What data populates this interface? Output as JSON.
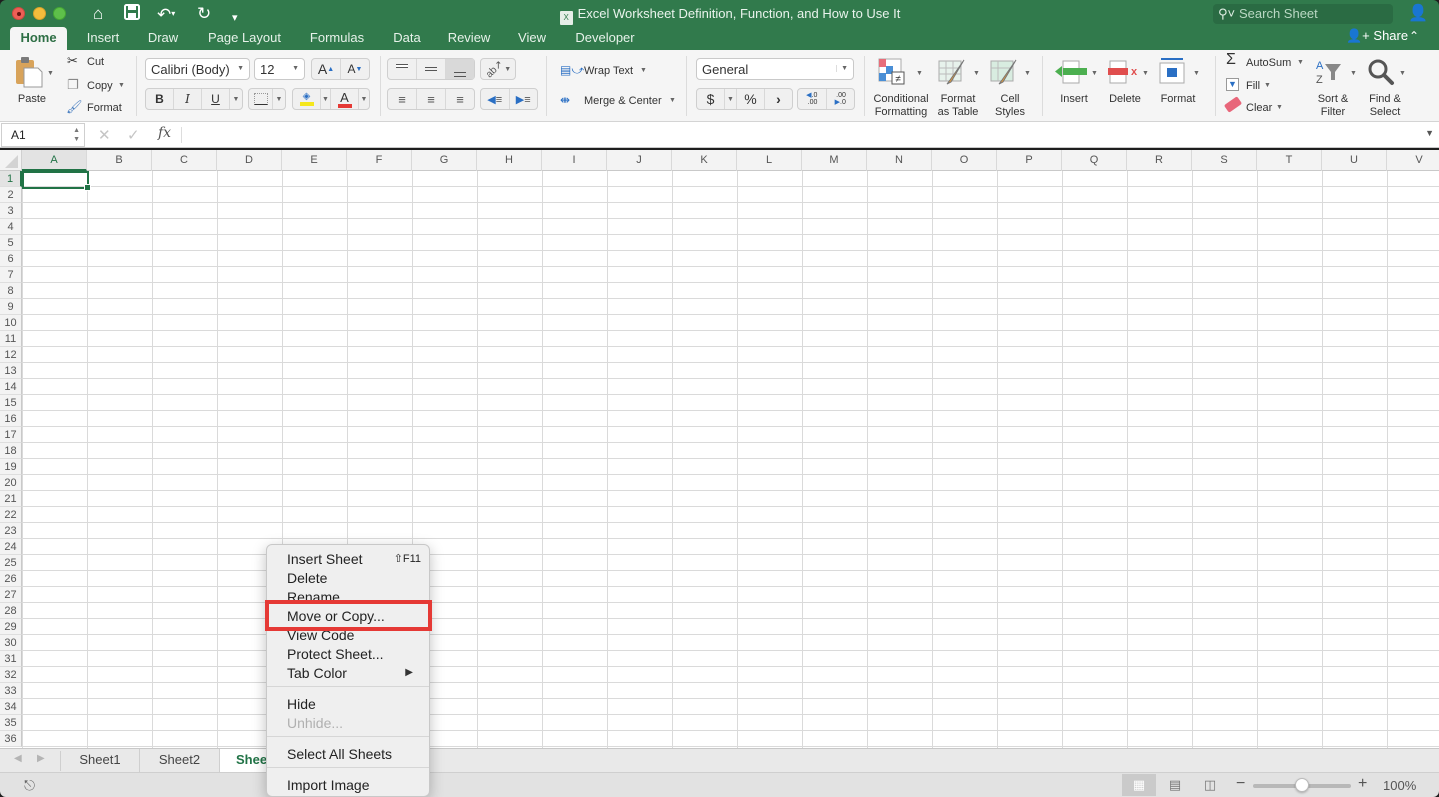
{
  "window": {
    "title": "Excel Worksheet Definition, Function, and How to Use It",
    "search_placeholder": "Search Sheet",
    "share_label": "Share"
  },
  "quick_access": [
    "home-icon",
    "save-icon",
    "undo-icon",
    "redo-icon",
    "customize-icon"
  ],
  "ribbon_tabs": [
    {
      "label": "Home",
      "active": true
    },
    {
      "label": "Insert"
    },
    {
      "label": "Draw"
    },
    {
      "label": "Page Layout"
    },
    {
      "label": "Formulas"
    },
    {
      "label": "Data"
    },
    {
      "label": "Review"
    },
    {
      "label": "View"
    },
    {
      "label": "Developer"
    }
  ],
  "ribbon": {
    "clipboard": {
      "paste": "Paste",
      "cut": "Cut",
      "copy": "Copy",
      "format": "Format"
    },
    "font": {
      "name": "Calibri (Body)",
      "size": "12",
      "bold": "B",
      "italic": "I",
      "underline": "U",
      "font_color": "#e53935",
      "fill_color": "#f5e71c"
    },
    "alignment": {
      "wrap_text": "Wrap Text",
      "merge_center": "Merge & Center"
    },
    "number": {
      "format": "General",
      "currency": "$",
      "percent": "%",
      "comma": "›",
      "inc_decimal": ".0\n.00",
      "dec_decimal": ".00\n.0"
    },
    "styles": {
      "conditional_1": "Conditional",
      "conditional_2": "Formatting",
      "format_table_1": "Format",
      "format_table_2": "as Table",
      "cell_styles_1": "Cell",
      "cell_styles_2": "Styles"
    },
    "cells": {
      "insert": "Insert",
      "delete": "Delete",
      "format": "Format"
    },
    "editing": {
      "autosum": "AutoSum",
      "fill": "Fill",
      "clear": "Clear",
      "sort_1": "Sort &",
      "sort_2": "Filter",
      "find_1": "Find &",
      "find_2": "Select"
    }
  },
  "formula_bar": {
    "name_box": "A1",
    "fx": "fx",
    "value": ""
  },
  "grid": {
    "columns": [
      "A",
      "B",
      "C",
      "D",
      "E",
      "F",
      "G",
      "H",
      "I",
      "J",
      "K",
      "L",
      "M",
      "N",
      "O",
      "P",
      "Q",
      "R",
      "S",
      "T",
      "U",
      "V"
    ],
    "rows": [
      "1",
      "2",
      "3",
      "4",
      "5",
      "6",
      "7",
      "8",
      "9",
      "10",
      "11",
      "12",
      "13",
      "14",
      "15",
      "16",
      "17",
      "18",
      "19",
      "20",
      "21",
      "22",
      "23",
      "24",
      "25",
      "26",
      "27",
      "28",
      "29",
      "30",
      "31",
      "32",
      "33",
      "34",
      "35",
      "36"
    ],
    "selected_cell": "A1"
  },
  "sheets": [
    {
      "label": "Sheet1"
    },
    {
      "label": "Sheet2"
    },
    {
      "label": "Shee",
      "active": true
    }
  ],
  "context_menu": {
    "items": [
      {
        "label": "Insert Sheet",
        "shortcut": "⇧F11"
      },
      {
        "label": "Delete"
      },
      {
        "label": "Rename"
      },
      {
        "label": "Move or Copy...",
        "highlighted": true
      },
      {
        "label": "View Code"
      },
      {
        "label": "Protect Sheet..."
      },
      {
        "label": "Tab Color",
        "submenu": true
      },
      {
        "label": "Hide"
      },
      {
        "label": "Unhide...",
        "disabled": true
      },
      {
        "label": "Select All Sheets"
      },
      {
        "label": "Import Image"
      }
    ],
    "highlight_color": "#e53935"
  },
  "status_bar": {
    "zoom_percent": "100%",
    "zoom_level": 100,
    "view_modes": [
      "normal-view",
      "page-layout-view",
      "page-break-view"
    ],
    "active_view": "normal-view"
  },
  "colors": {
    "brand_green": "#317a4c",
    "accent_green": "#217346"
  }
}
